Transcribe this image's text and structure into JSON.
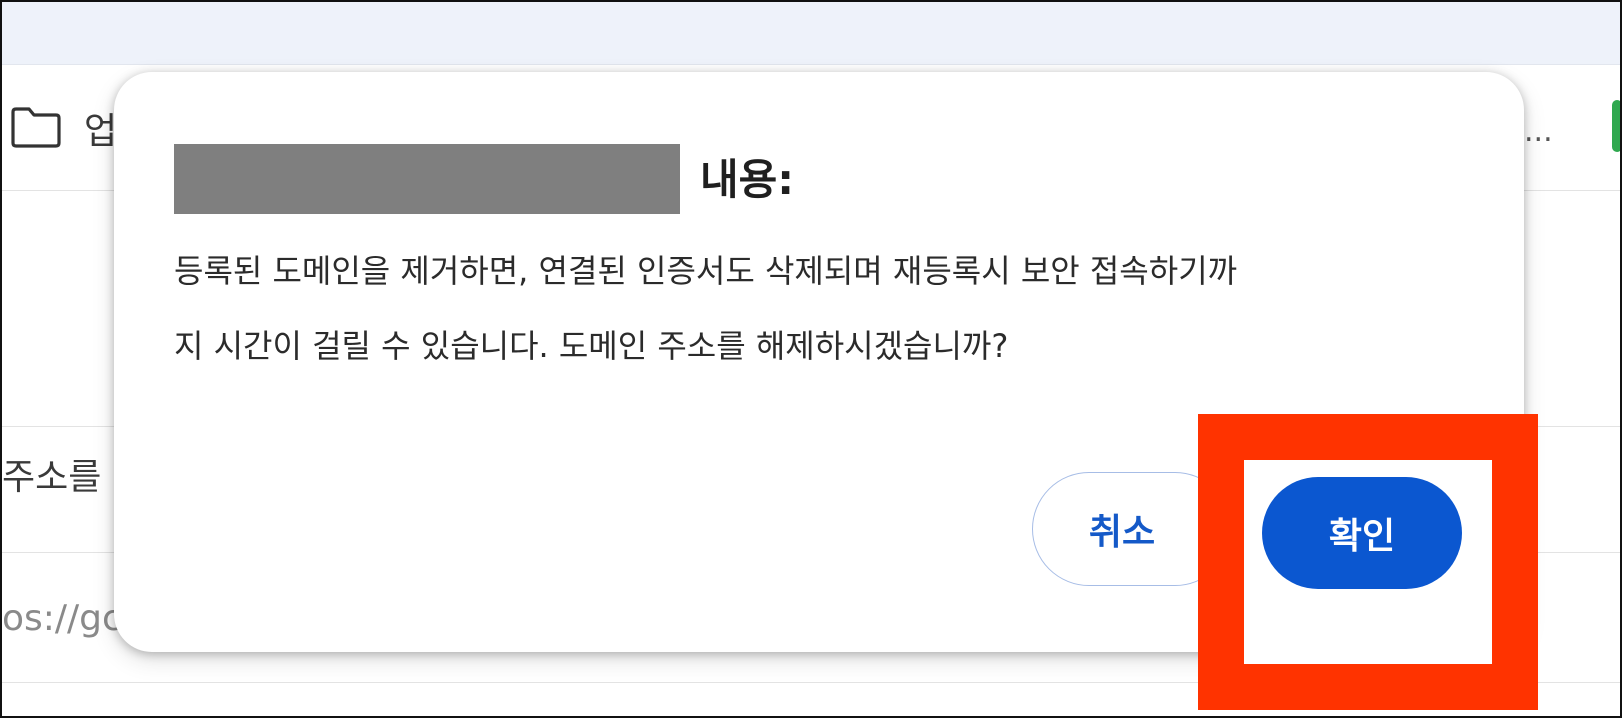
{
  "background": {
    "toolbar_text_fragment": "업",
    "more_dots": "...",
    "row_text_fragment": "주소를",
    "url_fragment": "os://gc"
  },
  "dialog": {
    "title_suffix": "내용:",
    "body_line1": "등록된 도메인을 제거하면, 연결된 인증서도 삭제되며 재등록시 보안 접속하기까",
    "body_line2": "지 시간이 걸릴 수 있습니다. 도메인 주소를 해제하시겠습니까?",
    "cancel_label": "취소",
    "confirm_label": "확인"
  },
  "colors": {
    "primary_button": "#0b57d0",
    "cancel_text": "#1459c8",
    "highlight": "#ff3300",
    "redaction": "#7f7f7f"
  },
  "icons": {
    "folder": "folder-icon"
  }
}
